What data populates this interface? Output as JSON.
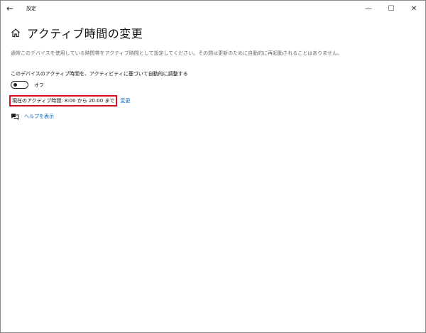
{
  "titlebar": {
    "app_title": "設定",
    "back_glyph": "←",
    "minimize_glyph": "—",
    "maximize_glyph": "☐",
    "close_glyph": "✕"
  },
  "page": {
    "title": "アクティブ時間の変更",
    "description": "通常このデバイスを使用している時間帯をアクティブ時間として設定してください。その間は更新のために自動的に再起動されることはありません。"
  },
  "auto_adjust": {
    "label": "このデバイスのアクティブ時間を、アクティビティに基づいて自動的に調整する",
    "toggle_state": "オフ"
  },
  "active_hours": {
    "current_text": "現在のアクティブ時間: 8:00 から 20:00 まで",
    "change_link": "変更"
  },
  "help": {
    "link_text": "ヘルプを表示"
  },
  "colors": {
    "link": "#0067c0",
    "highlight_border": "#d6111b"
  },
  "icons": {
    "back": "back-arrow-icon",
    "home": "home-icon",
    "help": "help-chat-icon"
  }
}
